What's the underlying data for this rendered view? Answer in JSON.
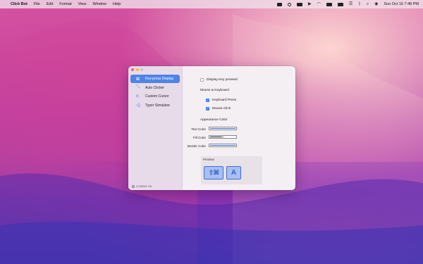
{
  "menubar": {
    "app_name": "Click Bot",
    "menus": [
      "File",
      "Edit",
      "Format",
      "View",
      "Window",
      "Help"
    ],
    "clock": "Sun Oct 16  7:48 PM"
  },
  "sidebar": {
    "items": [
      {
        "label": "Key-press Display",
        "icon": "keyboard-icon",
        "active": true
      },
      {
        "label": "Auto Clicker",
        "icon": "cursor-click-icon",
        "active": false
      },
      {
        "label": "Custom Cursor",
        "icon": "cursor-icon",
        "active": false
      },
      {
        "label": "Typer Simulator",
        "icon": "speaker-icon",
        "active": false
      }
    ],
    "contact": "Contact Us"
  },
  "content": {
    "display_key_pressed": {
      "label": "Display Key pressed",
      "checked": false
    },
    "mouse_keyboard_title": "Mouse & Keyboard",
    "keyboard_press": {
      "label": "Keyboard Press",
      "checked": true
    },
    "mouse_click": {
      "label": "Mouse Click",
      "checked": true
    },
    "appearance_title": "Appearance Color",
    "text_color_label": "Text Color",
    "fill_color_label": "Fill Color",
    "border_color_label": "Border Color",
    "colors": {
      "text": "#3d6fd6",
      "fill": "#111111",
      "border": "#3d6fd6",
      "accent": "#4f84e6"
    },
    "preview": {
      "title": "Preview",
      "modifier_key": "⇧⌘",
      "letter_key": "A"
    }
  }
}
